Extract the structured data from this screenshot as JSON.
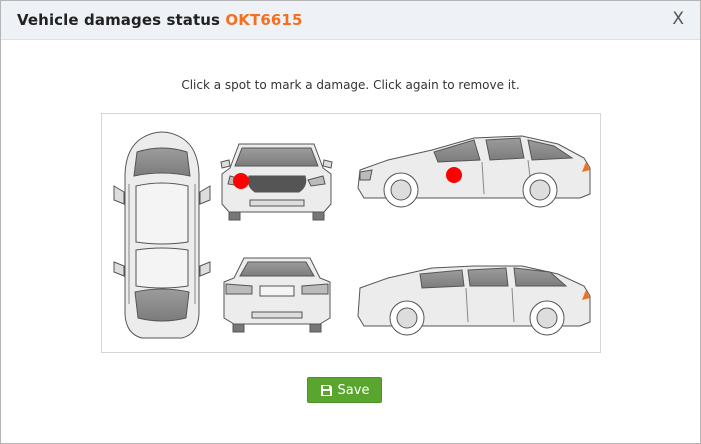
{
  "dialog": {
    "title": "Vehicle damages status",
    "plate": "OKT6615",
    "close_label": "X"
  },
  "instruction": "Click a spot to mark a damage. Click again to remove it.",
  "diagram": {
    "views": [
      "top",
      "front",
      "side-right",
      "rear",
      "side-left"
    ],
    "damage_marks": [
      {
        "view": "front",
        "location": "front-left headlight area"
      },
      {
        "view": "side-right",
        "location": "front passenger door"
      }
    ],
    "damage_color": "#ff0000"
  },
  "save_button": {
    "label": "Save",
    "icon": "floppy-disk-icon",
    "color": "#5aa52d"
  },
  "colors": {
    "accent": "#f37021",
    "header_bg": "#eef1f5"
  }
}
